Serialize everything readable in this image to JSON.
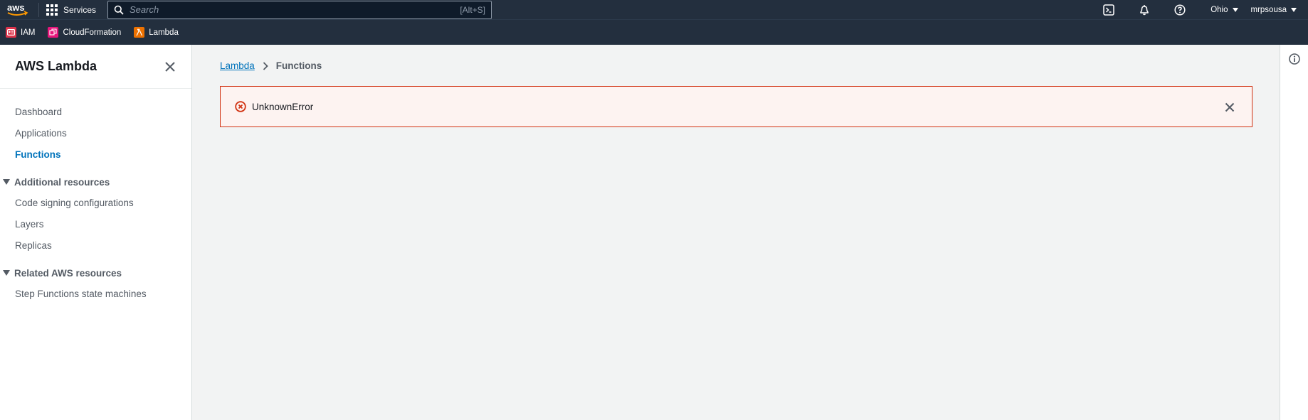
{
  "topnav": {
    "logo_text": "aws",
    "services_label": "Services",
    "search_placeholder": "Search",
    "search_shortcut": "[Alt+S]",
    "region_label": "Ohio",
    "user_label": "mrpsousa",
    "icons": [
      "cloudshell-icon",
      "notifications-icon",
      "help-icon"
    ]
  },
  "favorites": [
    {
      "label": "IAM",
      "icon": "iam-icon",
      "color": "#dd344c"
    },
    {
      "label": "CloudFormation",
      "icon": "cloudformation-icon",
      "color": "#e7157b"
    },
    {
      "label": "Lambda",
      "icon": "lambda-icon",
      "color": "#ed7100"
    }
  ],
  "sidebar": {
    "title": "AWS Lambda",
    "items": [
      {
        "label": "Dashboard"
      },
      {
        "label": "Applications"
      },
      {
        "label": "Functions",
        "active": true
      }
    ],
    "sections": [
      {
        "label": "Additional resources",
        "items": [
          {
            "label": "Code signing configurations"
          },
          {
            "label": "Layers"
          },
          {
            "label": "Replicas"
          }
        ]
      },
      {
        "label": "Related AWS resources",
        "items": [
          {
            "label": "Step Functions state machines"
          }
        ]
      }
    ]
  },
  "breadcrumb": {
    "link": "Lambda",
    "current": "Functions"
  },
  "alert": {
    "message": "UnknownError",
    "color": "#d13212"
  },
  "colors": {
    "nav_bg": "#232f3e",
    "accent": "#0073bb",
    "page_bg": "#f2f3f3"
  }
}
